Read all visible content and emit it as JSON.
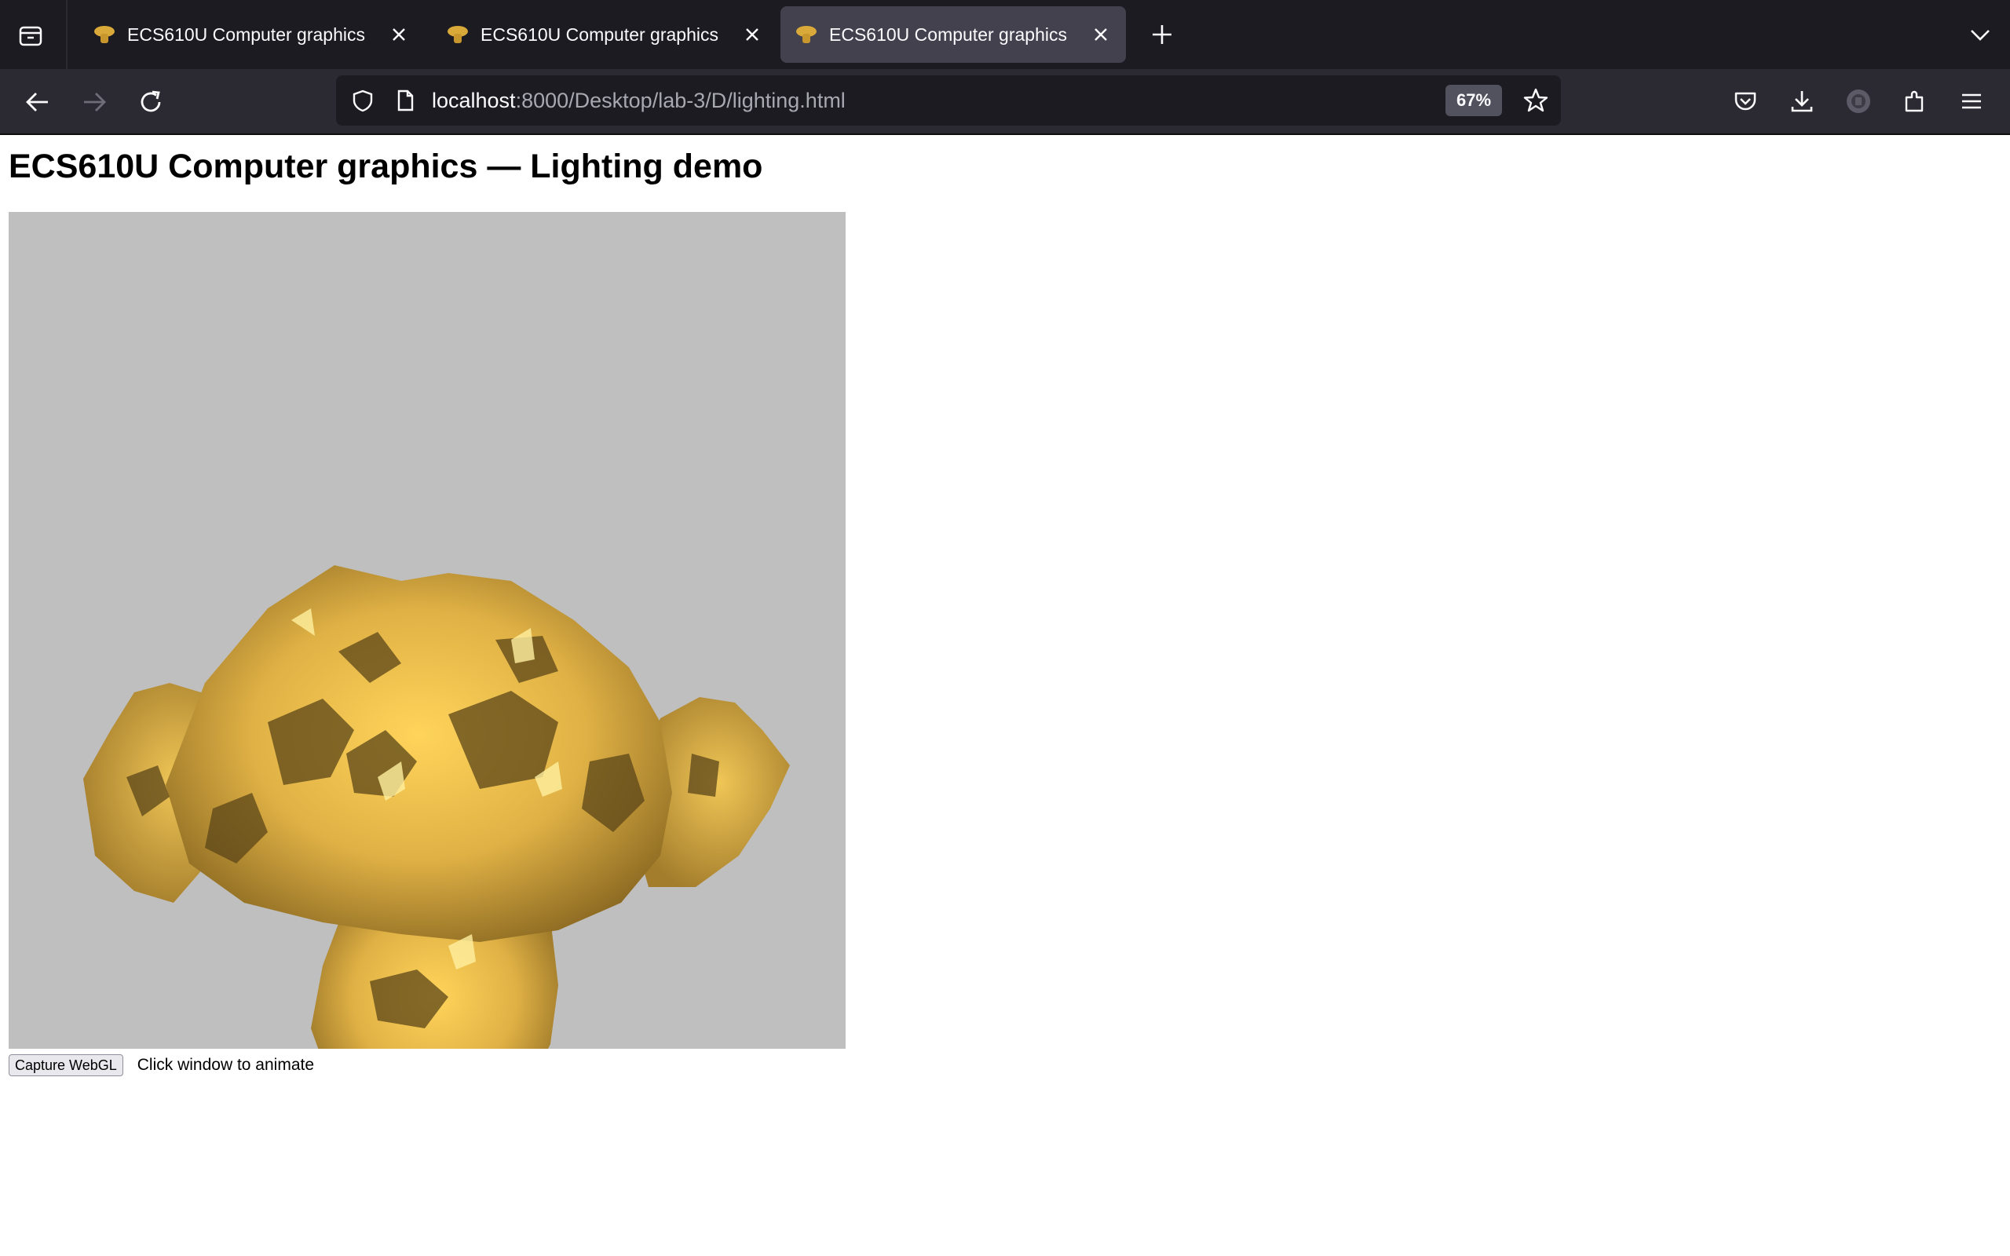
{
  "browser": {
    "tabs": [
      {
        "title": "ECS610U Computer graphics",
        "active": false
      },
      {
        "title": "ECS610U Computer graphics",
        "active": false
      },
      {
        "title": "ECS610U Computer graphics",
        "active": true
      }
    ],
    "url": {
      "host": "localhost",
      "rest": ":8000/Desktop/lab-3/D/lighting.html"
    },
    "zoom": "67%"
  },
  "page": {
    "title": "ECS610U Computer graphics — Lighting demo",
    "capture_button": "Capture WebGL",
    "hint": "Click window to animate"
  },
  "colors": {
    "tabstrip": "#1c1b22",
    "navbar": "#2b2a33",
    "urlbar": "#1c1b22",
    "canvas_background": "#bfbfbf",
    "model_gold": "#e8b84a",
    "model_shadow": "#6b5520"
  },
  "icons": [
    "tab-overview-icon",
    "favicon-icon",
    "close-icon",
    "plus-icon",
    "chevron-down-icon",
    "back-arrow-icon",
    "forward-arrow-icon",
    "reload-icon",
    "shield-icon",
    "page-icon",
    "star-icon",
    "pocket-icon",
    "download-icon",
    "account-icon",
    "extensions-icon",
    "menu-icon"
  ]
}
